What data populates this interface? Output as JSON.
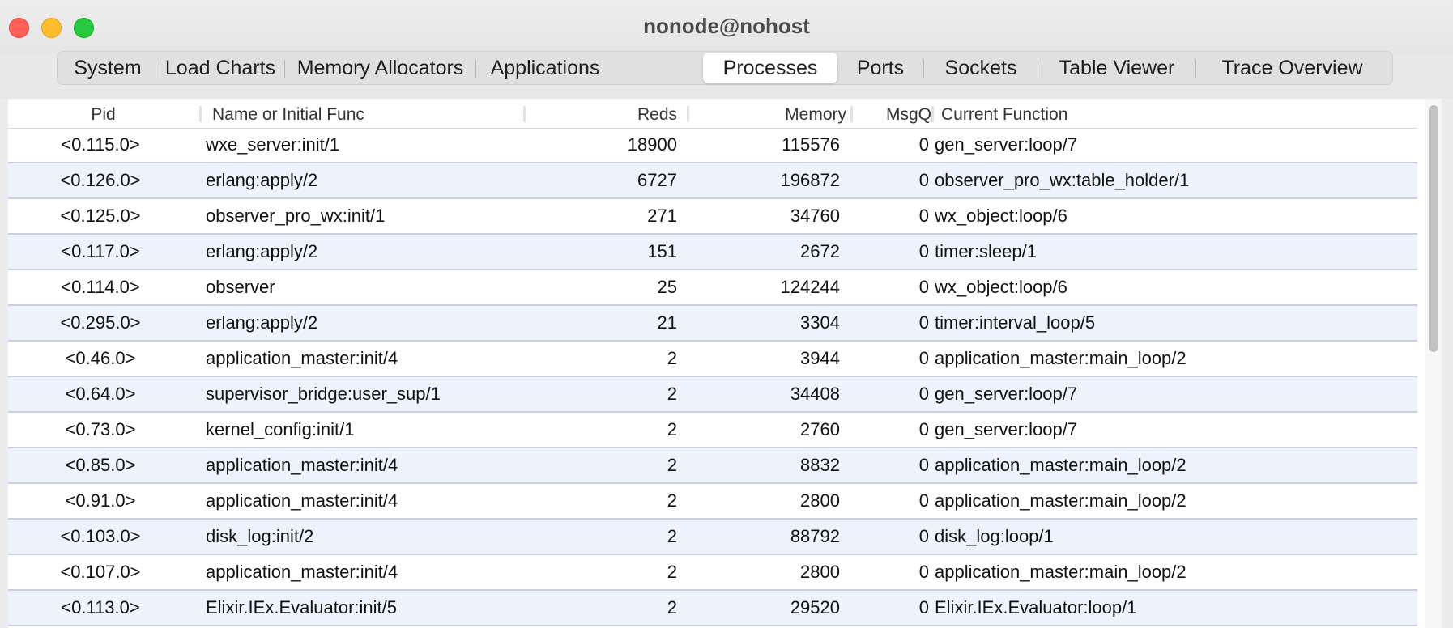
{
  "window": {
    "title": "nonode@nohost"
  },
  "tabs": [
    {
      "label": "System",
      "active": false
    },
    {
      "label": "Load Charts",
      "active": false
    },
    {
      "label": "Memory Allocators",
      "active": false
    },
    {
      "label": "Applications",
      "active": false
    },
    {
      "label": "Processes",
      "active": true
    },
    {
      "label": "Ports",
      "active": false
    },
    {
      "label": "Sockets",
      "active": false
    },
    {
      "label": "Table Viewer",
      "active": false
    },
    {
      "label": "Trace Overview",
      "active": false
    }
  ],
  "table": {
    "columns": [
      "Pid",
      "Name or Initial Func",
      "Reds",
      "Memory",
      "MsgQ",
      "Current Function"
    ],
    "rows": [
      [
        "<0.115.0>",
        "wxe_server:init/1",
        "18900",
        "115576",
        "0",
        "gen_server:loop/7"
      ],
      [
        "<0.126.0>",
        "erlang:apply/2",
        "6727",
        "196872",
        "0",
        "observer_pro_wx:table_holder/1"
      ],
      [
        "<0.125.0>",
        "observer_pro_wx:init/1",
        "271",
        "34760",
        "0",
        "wx_object:loop/6"
      ],
      [
        "<0.117.0>",
        "erlang:apply/2",
        "151",
        "2672",
        "0",
        "timer:sleep/1"
      ],
      [
        "<0.114.0>",
        "observer",
        "25",
        "124244",
        "0",
        "wx_object:loop/6"
      ],
      [
        "<0.295.0>",
        "erlang:apply/2",
        "21",
        "3304",
        "0",
        "timer:interval_loop/5"
      ],
      [
        "<0.46.0>",
        "application_master:init/4",
        "2",
        "3944",
        "0",
        "application_master:main_loop/2"
      ],
      [
        "<0.64.0>",
        "supervisor_bridge:user_sup/1",
        "2",
        "34408",
        "0",
        "gen_server:loop/7"
      ],
      [
        "<0.73.0>",
        "kernel_config:init/1",
        "2",
        "2760",
        "0",
        "gen_server:loop/7"
      ],
      [
        "<0.85.0>",
        "application_master:init/4",
        "2",
        "8832",
        "0",
        "application_master:main_loop/2"
      ],
      [
        "<0.91.0>",
        "application_master:init/4",
        "2",
        "2800",
        "0",
        "application_master:main_loop/2"
      ],
      [
        "<0.103.0>",
        "disk_log:init/2",
        "2",
        "88792",
        "0",
        "disk_log:loop/1"
      ],
      [
        "<0.107.0>",
        "application_master:init/4",
        "2",
        "2800",
        "0",
        "application_master:main_loop/2"
      ],
      [
        "<0.113.0>",
        "Elixir.IEx.Evaluator:init/5",
        "2",
        "29520",
        "0",
        "Elixir.IEx.Evaluator:loop/1"
      ]
    ]
  },
  "colors": {
    "row_alt": "#edf3fd",
    "row_separator": "#c9d0dc",
    "close": "#fe5f57",
    "minimize": "#febc2e",
    "maximize": "#28c840"
  }
}
